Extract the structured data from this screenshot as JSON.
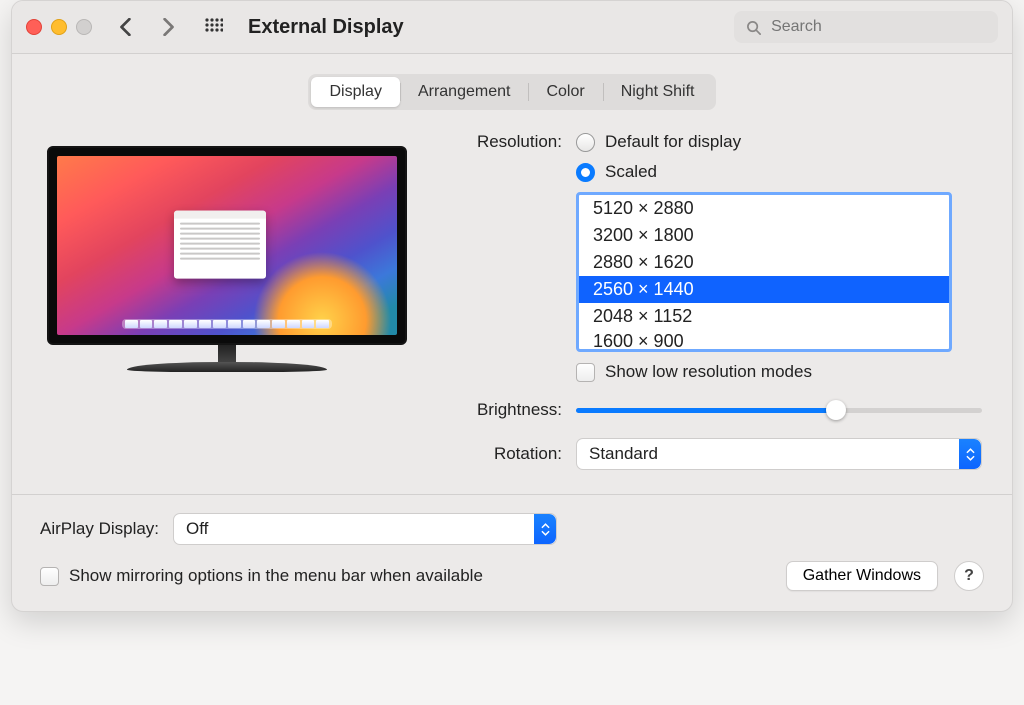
{
  "window": {
    "title": "External Display"
  },
  "search": {
    "placeholder": "Search"
  },
  "tabs": {
    "display": "Display",
    "arrangement": "Arrangement",
    "color": "Color",
    "night_shift": "Night Shift",
    "active": "display"
  },
  "labels": {
    "resolution": "Resolution:",
    "brightness": "Brightness:",
    "rotation": "Rotation:",
    "airplay": "AirPlay Display:"
  },
  "resolution": {
    "default_label": "Default for display",
    "scaled_label": "Scaled",
    "mode": "scaled",
    "options": [
      "5120 × 2880",
      "3200 × 1800",
      "2880 × 1620",
      "2560 × 1440",
      "2048 × 1152",
      "1600 × 900"
    ],
    "selected": "2560 × 1440",
    "show_low_label": "Show low resolution modes",
    "show_low_checked": false
  },
  "brightness": {
    "value_pct": 64
  },
  "rotation": {
    "value": "Standard"
  },
  "airplay": {
    "label": "AirPlay Display:",
    "value": "Off"
  },
  "mirroring": {
    "label": "Show mirroring options in the menu bar when available",
    "checked": false
  },
  "buttons": {
    "gather": "Gather Windows"
  }
}
